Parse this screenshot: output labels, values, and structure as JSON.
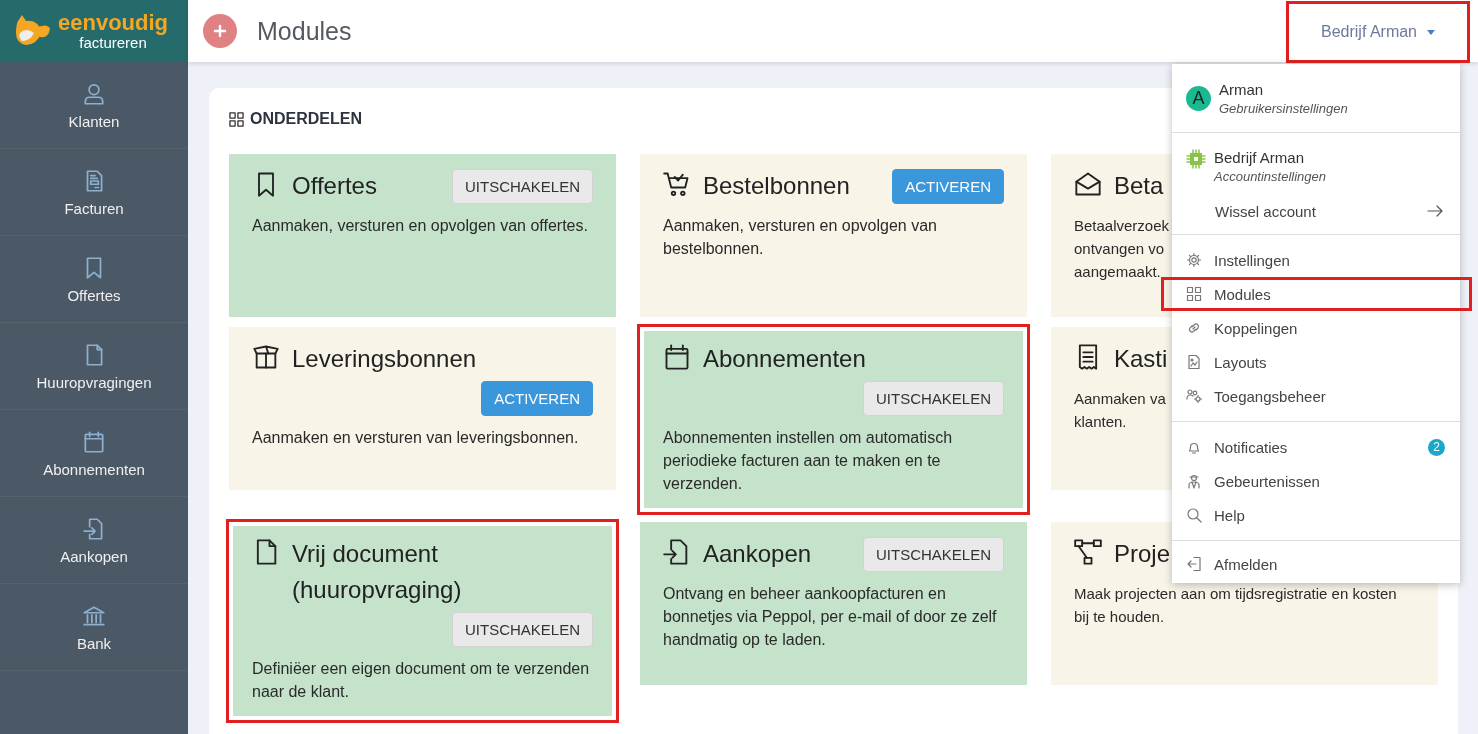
{
  "logo": {
    "name": "eenvoudig",
    "tagline": "factureren"
  },
  "sidebar": {
    "items": [
      {
        "label": "Klanten"
      },
      {
        "label": "Facturen"
      },
      {
        "label": "Offertes"
      },
      {
        "label": "Huuropvragingen"
      },
      {
        "label": "Abonnementen"
      },
      {
        "label": "Aankopen"
      },
      {
        "label": "Bank"
      }
    ]
  },
  "header": {
    "title": "Modules",
    "account": {
      "label": "Bedrijf Arman",
      "highlighted": true
    }
  },
  "section": {
    "title": "ONDERDELEN"
  },
  "modules": [
    {
      "title": "Offertes",
      "enabled": true,
      "highlighted": false,
      "button": "UITSCHAKELEN",
      "description": "Aanmaken, versturen en opvolgen van offertes."
    },
    {
      "title": "Bestelbonnen",
      "enabled": false,
      "highlighted": false,
      "button": "ACTIVEREN",
      "description": "Aanmaken, versturen en opvolgen van bestelbonnen."
    },
    {
      "title": "Beta",
      "enabled": false,
      "highlighted": false,
      "description_lines": [
        "Betaalverzoek",
        "ontvangen vo",
        "aangemaakt."
      ]
    },
    {
      "title": "Leveringsbonnen",
      "enabled": false,
      "highlighted": false,
      "button": "ACTIVEREN",
      "description": "Aanmaken en versturen van leveringsbonnen."
    },
    {
      "title": "Abonnementen",
      "enabled": true,
      "highlighted": true,
      "button": "UITSCHAKELEN",
      "description": "Abonnementen instellen om automatisch periodieke facturen aan te maken en te verzenden."
    },
    {
      "title": "Kasti",
      "enabled": false,
      "highlighted": false,
      "description_lines": [
        "Aanmaken va",
        "klanten."
      ]
    },
    {
      "title": "Vrij document (huuropvraging)",
      "enabled": true,
      "highlighted": true,
      "button": "UITSCHAKELEN",
      "description": "Definiëer een eigen document om te verzenden naar de klant."
    },
    {
      "title": "Aankopen",
      "enabled": true,
      "highlighted": false,
      "button": "UITSCHAKELEN",
      "description": "Ontvang en beheer aankoopfacturen en bonnetjes via Peppol, per e-mail of door ze zelf handmatig op te laden."
    },
    {
      "title": "Proje",
      "enabled": false,
      "highlighted": false,
      "description_lines": [
        "Maak projecten aan om tijdsregistratie en kosten",
        "bij te houden."
      ]
    }
  ],
  "account_menu": {
    "user": {
      "avatar": "A",
      "name": "Arman",
      "subtitle": "Gebruikersinstellingen"
    },
    "account": {
      "name": "Bedrijf Arman",
      "subtitle": "Accountinstellingen",
      "switch_label": "Wissel account"
    },
    "groups": [
      [
        {
          "label": "Instellingen",
          "highlighted": false
        },
        {
          "label": "Modules",
          "highlighted": true
        },
        {
          "label": "Koppelingen",
          "highlighted": false
        },
        {
          "label": "Layouts",
          "highlighted": false
        },
        {
          "label": "Toegangsbeheer",
          "highlighted": false
        }
      ],
      [
        {
          "label": "Notificaties",
          "highlighted": false,
          "badge": "2"
        },
        {
          "label": "Gebeurtenissen",
          "highlighted": false
        },
        {
          "label": "Help",
          "highlighted": false
        }
      ],
      [
        {
          "label": "Afmelden",
          "highlighted": false
        }
      ]
    ]
  }
}
